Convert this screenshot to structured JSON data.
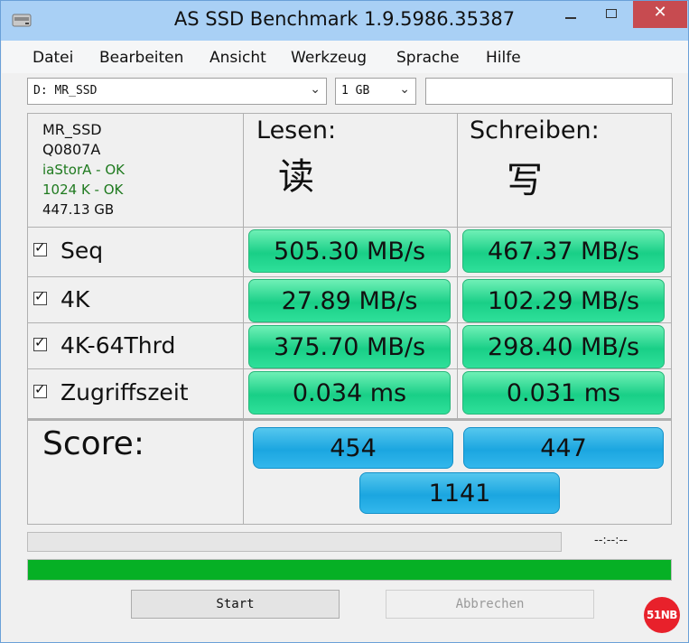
{
  "window": {
    "title": "AS SSD Benchmark 1.9.5986.35387",
    "controls": {
      "minimize": "minimize-icon",
      "maximize": "maximize-icon",
      "close": "✕"
    }
  },
  "menu": [
    "Datei",
    "Bearbeiten",
    "Ansicht",
    "Werkzeug",
    "Sprache",
    "Hilfe"
  ],
  "toolbar": {
    "drive_select": "D: MR_SSD",
    "size_select": "1 GB",
    "text_field": ""
  },
  "drive_info": {
    "name": "MR_SSD",
    "firmware": "Q0807A",
    "driver": "iaStorA - OK",
    "alignment": "1024 K - OK",
    "capacity": "447.13 GB"
  },
  "columns": {
    "read": {
      "label": "Lesen:",
      "cn": "读"
    },
    "write": {
      "label": "Schreiben:",
      "cn": "写"
    }
  },
  "tests": [
    {
      "label": "Seq",
      "checked": true,
      "read": "505.30 MB/s",
      "write": "467.37 MB/s"
    },
    {
      "label": "4K",
      "checked": true,
      "read": "27.89 MB/s",
      "write": "102.29 MB/s"
    },
    {
      "label": "4K-64Thrd",
      "checked": true,
      "read": "375.70 MB/s",
      "write": "298.40 MB/s"
    },
    {
      "label": "Zugriffszeit",
      "checked": true,
      "read": "0.034 ms",
      "write": "0.031 ms"
    }
  ],
  "score": {
    "label": "Score:",
    "read": "454",
    "write": "447",
    "total": "1141"
  },
  "progress": {
    "time_readout": "--:--:--",
    "main_fraction": 1.0,
    "small_fraction": 0.0
  },
  "buttons": {
    "start": "Start",
    "abort": "Abbrechen"
  },
  "watermark": "51NB",
  "colors": {
    "result_green": "#19cf87",
    "score_blue": "#1ba6e0",
    "progress_green": "#06b025",
    "close_red": "#c74b50",
    "ok_text": "#1f7a1f"
  }
}
